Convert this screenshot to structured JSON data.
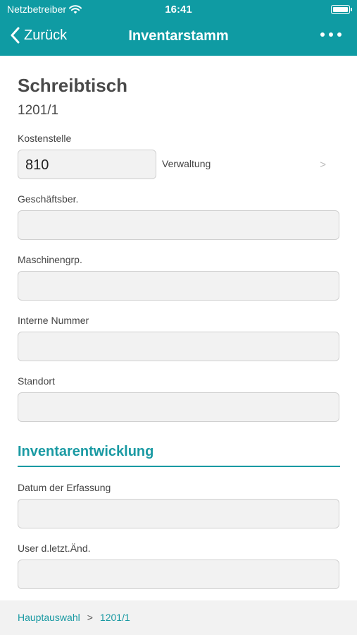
{
  "status_bar": {
    "carrier": "Netzbetreiber",
    "time": "16:41"
  },
  "nav": {
    "back_label": "Zurück",
    "title": "Inventarstamm"
  },
  "item": {
    "name": "Schreibtisch",
    "number": "1201/1"
  },
  "fields": {
    "kostenstelle": {
      "label": "Kostenstelle",
      "value": "810",
      "description": "Verwaltung"
    },
    "geschaeftsber": {
      "label": "Geschäftsber.",
      "value": ""
    },
    "maschinengrp": {
      "label": "Maschinengrp.",
      "value": ""
    },
    "interne_nummer": {
      "label": "Interne Nummer",
      "value": ""
    },
    "standort": {
      "label": "Standort",
      "value": ""
    }
  },
  "section": {
    "title": "Inventarentwicklung"
  },
  "section_fields": {
    "datum_erfassung": {
      "label": "Datum der Erfassung",
      "value": ""
    },
    "user_letzt_aend": {
      "label": "User d.letzt.Änd.",
      "value": ""
    }
  },
  "breadcrumb": {
    "items": [
      "Hauptauswahl",
      "1201/1"
    ],
    "separator": ">"
  },
  "colors": {
    "accent": "#0f9ba3",
    "field_bg": "#f2f2f2"
  },
  "icons": {
    "back": "chevron-left-icon",
    "more": "more-icon",
    "wifi": "wifi-icon",
    "battery": "battery-icon",
    "disclosure": "chevron-right-icon"
  }
}
